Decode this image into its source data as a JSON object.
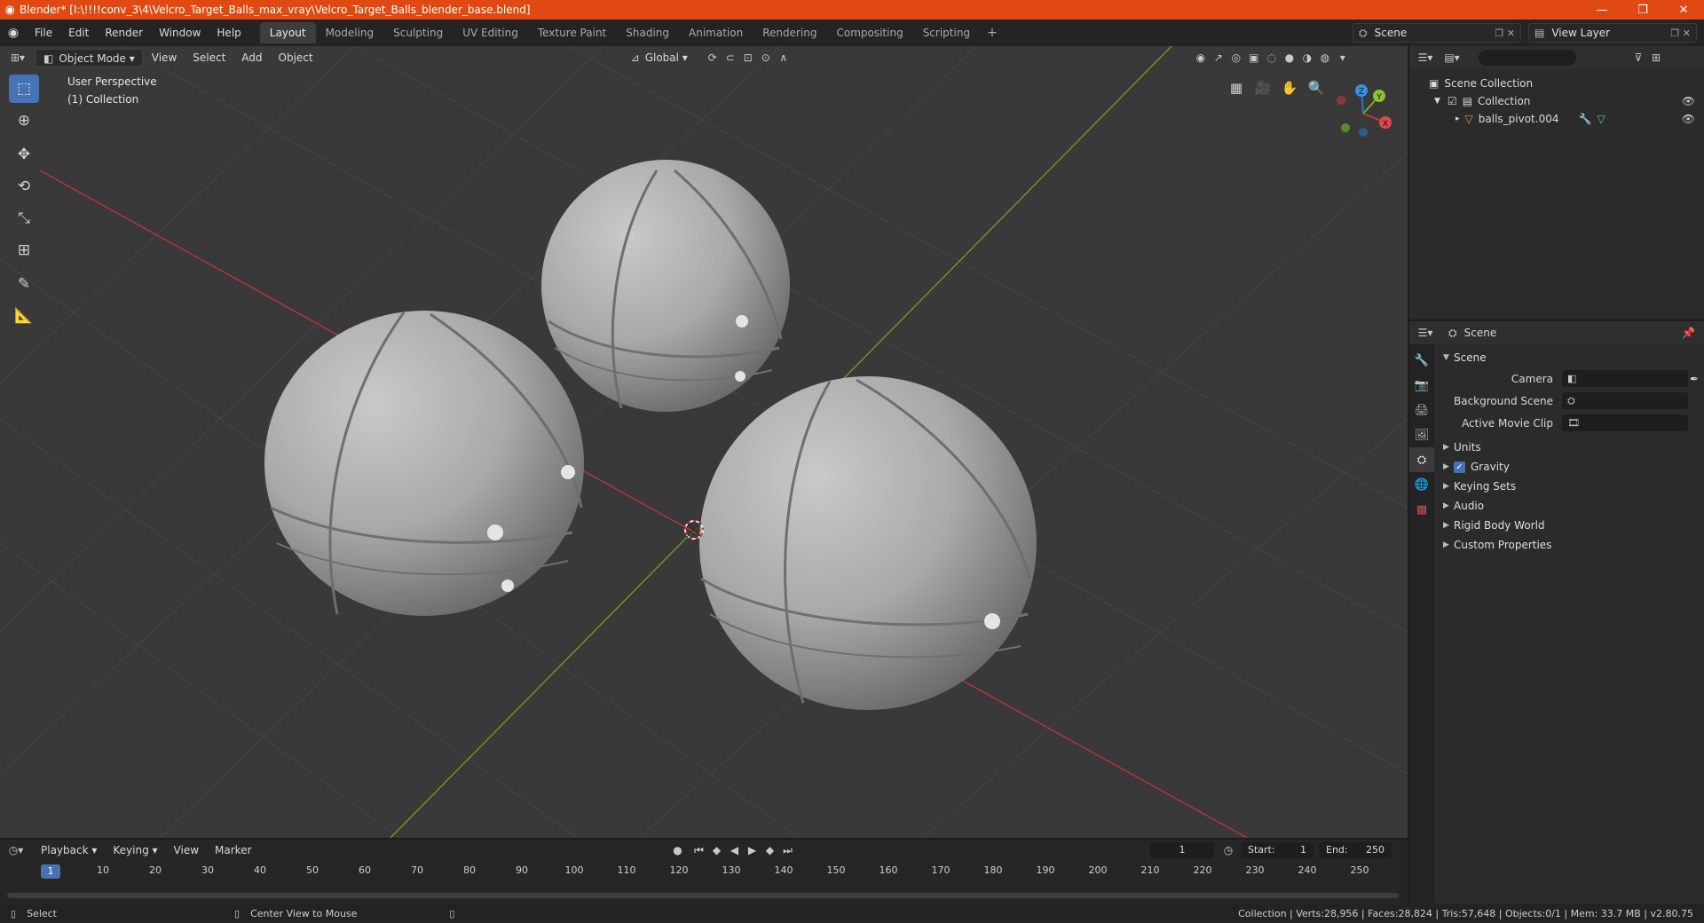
{
  "window": {
    "title": "Blender* [I:\\!!!!conv_3\\4\\Velcro_Target_Balls_max_vray\\Velcro_Target_Balls_blender_base.blend]",
    "controls": [
      "—",
      "❐",
      "✕"
    ]
  },
  "menu": [
    "File",
    "Edit",
    "Render",
    "Window",
    "Help"
  ],
  "workspaces": [
    "Layout",
    "Modeling",
    "Sculpting",
    "UV Editing",
    "Texture Paint",
    "Shading",
    "Animation",
    "Rendering",
    "Compositing",
    "Scripting"
  ],
  "active_workspace": "Layout",
  "scene_selector": "Scene",
  "view_layer_selector": "View Layer",
  "viewport": {
    "mode": "Object Mode",
    "menus": [
      "View",
      "Select",
      "Add",
      "Object"
    ],
    "transform_orientation": "Global",
    "perspective_label": "User Perspective",
    "collection_label": "(1) Collection",
    "gizmo_axes": [
      "X",
      "Y",
      "Z"
    ]
  },
  "tools": [
    "select-box-icon",
    "cursor-icon",
    "move-icon",
    "rotate-icon",
    "scale-icon",
    "transform-icon",
    "annotate-icon",
    "measure-icon"
  ],
  "outliner": {
    "search_placeholder": "",
    "root": "Scene Collection",
    "collection": "Collection",
    "object": "balls_pivot.004"
  },
  "properties": {
    "header": "Scene",
    "panel": "Scene",
    "fields": [
      {
        "label": "Camera",
        "value": ""
      },
      {
        "label": "Background Scene",
        "value": ""
      },
      {
        "label": "Active Movie Clip",
        "value": ""
      }
    ],
    "sections": [
      "Units",
      "Gravity",
      "Keying Sets",
      "Audio",
      "Rigid Body World",
      "Custom Properties"
    ],
    "gravity_checked": true
  },
  "timeline": {
    "menus": [
      "Playback",
      "Keying",
      "View",
      "Marker"
    ],
    "current_frame": "1",
    "start_label": "Start:",
    "start": "1",
    "end_label": "End:",
    "end": "250",
    "ticks": [
      "10",
      "20",
      "30",
      "40",
      "50",
      "60",
      "70",
      "80",
      "90",
      "100",
      "110",
      "120",
      "130",
      "140",
      "150",
      "160",
      "170",
      "180",
      "190",
      "200",
      "210",
      "220",
      "230",
      "240",
      "250"
    ]
  },
  "status": {
    "left_action": "Select",
    "middle_action": "Center View to Mouse",
    "stats": "Collection | Verts:28,956 | Faces:28,824 | Tris:57,648 | Objects:0/1 | Mem: 33.7 MB | v2.80.75"
  },
  "colors": {
    "titlebar": "#e04a12",
    "accent": "#4772b3",
    "x_axis": "#c2363a",
    "y_axis": "#7ba82a"
  }
}
